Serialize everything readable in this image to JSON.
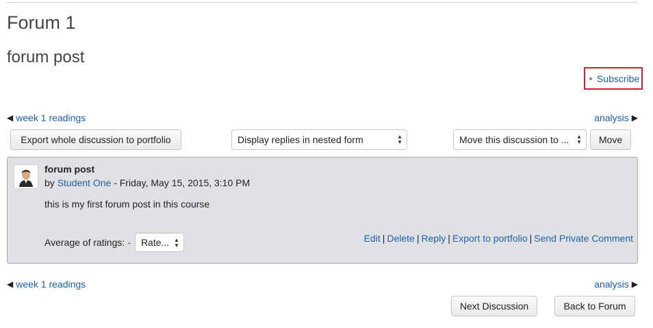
{
  "page": {
    "forum_title": "Forum 1",
    "discussion_title": "forum post"
  },
  "subscribe": {
    "label": "Subscribe"
  },
  "nav_top": {
    "prev_label": "week 1 readings",
    "next_label": "analysis",
    "prev_icon": "triangle-left-icon",
    "next_icon": "triangle-right-icon"
  },
  "toolbar": {
    "export_label": "Export whole discussion to portfolio",
    "display_mode_value": "Display replies in nested form",
    "move_select_value": "Move this discussion to ...",
    "move_label": "Move"
  },
  "post": {
    "subject": "forum post",
    "by_prefix": "by",
    "author": "Student One",
    "date": " - Friday, May 15, 2015, 3:10 PM",
    "body": "this is my first forum post in this course",
    "ratings_label": "Average of ratings:",
    "ratings_value": "-",
    "rate_value": "Rate...",
    "commands": {
      "edit": "Edit",
      "delete": "Delete",
      "reply": "Reply",
      "export": "Export to portfolio",
      "private_comment": "Send Private Comment"
    }
  },
  "nav_bottom": {
    "prev_label": "week 1 readings",
    "next_label": "analysis"
  },
  "footer": {
    "next_discussion_label": "Next Discussion",
    "back_label": "Back to Forum"
  },
  "colors": {
    "link": "#1d61a8",
    "highlight_border": "#d0202a",
    "post_background": "#dfe1e4"
  }
}
